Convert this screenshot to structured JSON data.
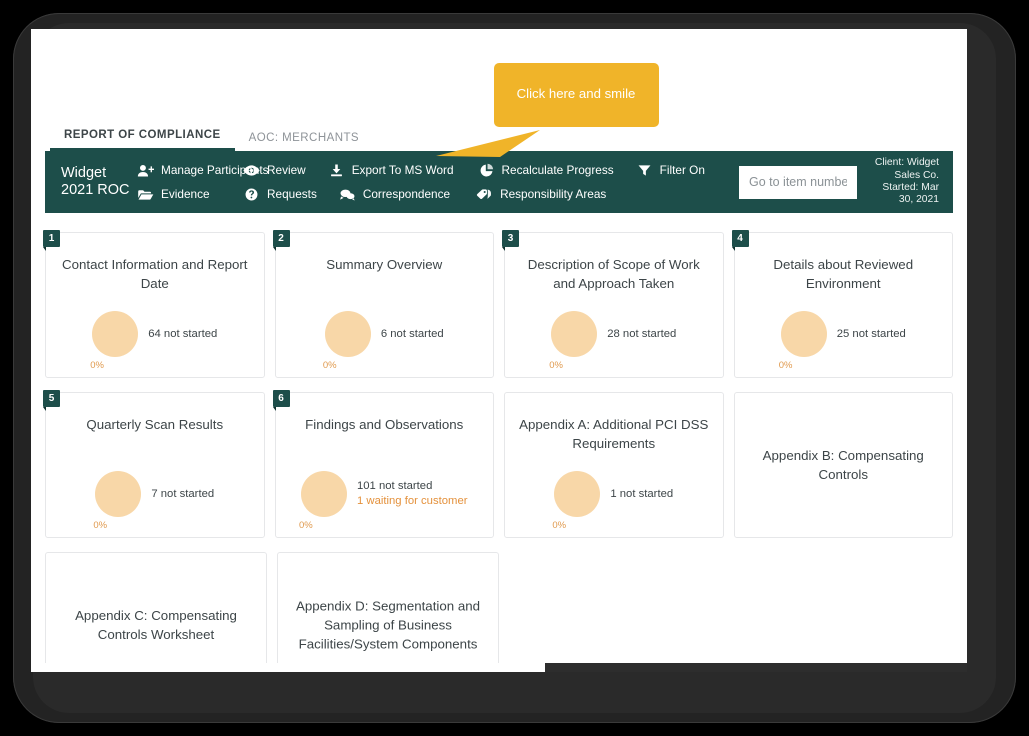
{
  "tabs": [
    {
      "label": "REPORT OF COMPLIANCE",
      "active": true
    },
    {
      "label": "AOC: MERCHANTS",
      "active": false
    }
  ],
  "toolbar": {
    "brand_line1": "Widget",
    "brand_line2": "2021 ROC",
    "menu_row1": [
      {
        "label": "Manage Participants",
        "icon": "user-plus-icon"
      },
      {
        "label": "Review",
        "icon": "eye-icon"
      },
      {
        "label": "Export To MS Word",
        "icon": "download-icon"
      },
      {
        "label": "Recalculate Progress",
        "icon": "pie-chart-icon"
      },
      {
        "label": "Filter On",
        "icon": "funnel-icon"
      }
    ],
    "menu_row2": [
      {
        "label": "Evidence",
        "icon": "folder-icon"
      },
      {
        "label": "Requests",
        "icon": "question-circle-icon"
      },
      {
        "label": "Correspondence",
        "icon": "chat-icon"
      },
      {
        "label": "Responsibility Areas",
        "icon": "tag-icon"
      }
    ],
    "goto_placeholder": "Go to item number",
    "goto_value": "",
    "client_line1": "Client: Widget",
    "client_line2": "Sales Co.",
    "client_line3": "Started: Mar",
    "client_line4": "30, 2021"
  },
  "callout": {
    "text": "Click here and smile",
    "color": "#F0B429"
  },
  "colors": {
    "header_green": "#1D4E4A",
    "donut_peach": "#F8D7A8",
    "warn_orange": "#E4913C",
    "text_dark": "#3D4548"
  },
  "cards": [
    {
      "number": "1",
      "title": "Contact Information and Report Date",
      "percent": "0%",
      "stat_main": "64 not started",
      "stat_warn": ""
    },
    {
      "number": "2",
      "title": "Summary Overview",
      "percent": "0%",
      "stat_main": "6 not started",
      "stat_warn": ""
    },
    {
      "number": "3",
      "title": "Description of Scope of Work and Approach Taken",
      "percent": "0%",
      "stat_main": "28 not started",
      "stat_warn": ""
    },
    {
      "number": "4",
      "title": "Details about Reviewed Environment",
      "percent": "0%",
      "stat_main": "25 not started",
      "stat_warn": ""
    },
    {
      "number": "5",
      "title": "Quarterly Scan Results",
      "percent": "0%",
      "stat_main": "7 not started",
      "stat_warn": ""
    },
    {
      "number": "6",
      "title": "Findings and Observations",
      "percent": "0%",
      "stat_main": "101 not started",
      "stat_warn": "1 waiting for customer"
    },
    {
      "number": "",
      "title": "Appendix A: Additional PCI DSS Requirements",
      "percent": "0%",
      "stat_main": "1 not started",
      "stat_warn": ""
    },
    {
      "number": "",
      "title": "Appendix B: Compensating Controls",
      "percent": "",
      "stat_main": "",
      "stat_warn": ""
    },
    {
      "number": "",
      "title": "Appendix C: Compensating Controls Worksheet",
      "percent": "",
      "stat_main": "",
      "stat_warn": ""
    },
    {
      "number": "",
      "title": "Appendix D: Segmentation and Sampling of Business Facilities/System Components",
      "percent": "",
      "stat_main": "",
      "stat_warn": ""
    }
  ]
}
